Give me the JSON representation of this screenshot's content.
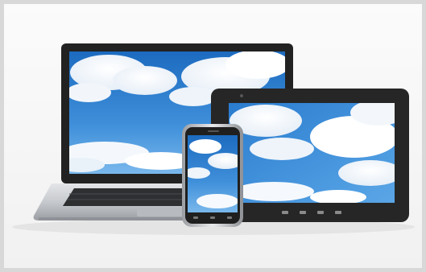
{
  "image": {
    "subject": "devices",
    "devices": [
      {
        "name": "laptop"
      },
      {
        "name": "tablet"
      },
      {
        "name": "smartphone"
      }
    ],
    "screen_content": "cloud-sky",
    "colors": {
      "sky_top": "#1e6fc4",
      "sky_bottom": "#6fb2ea",
      "bezel": "#2b2b2b",
      "laptop_body": "#c9ccd0",
      "background": "#f6f6f6"
    }
  }
}
